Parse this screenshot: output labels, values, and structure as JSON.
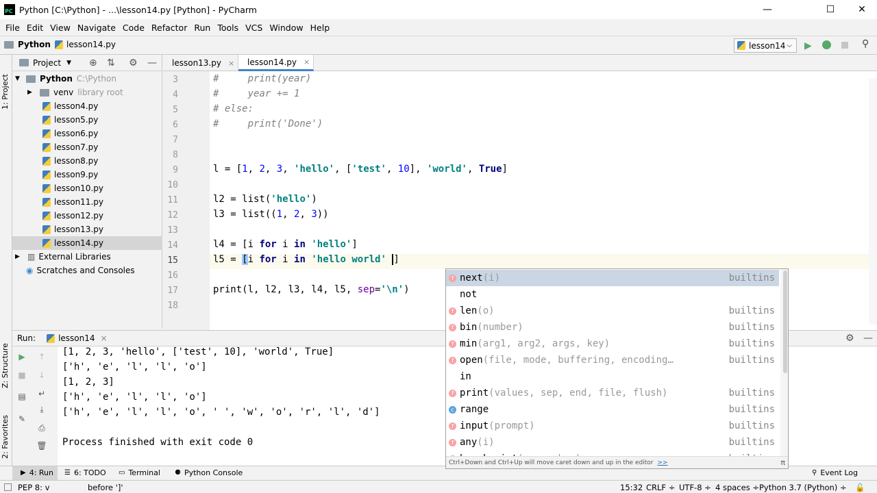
{
  "window": {
    "title": "Python [C:\\Python] - ...\\lesson14.py [Python] - PyCharm",
    "minimize": "—",
    "maximize": "☐",
    "close": "✕"
  },
  "menu": [
    "File",
    "Edit",
    "View",
    "Navigate",
    "Code",
    "Refactor",
    "Run",
    "Tools",
    "VCS",
    "Window",
    "Help"
  ],
  "breadcrumb": {
    "project": "Python",
    "file": "lesson14.py"
  },
  "run_config": {
    "label": "lesson14",
    "run_icon": "play-icon",
    "debug_icon": "bug-icon",
    "stop_icon": "stop-icon",
    "search_icon": "search-icon"
  },
  "left_strip": {
    "project_tab": "1: Project",
    "structure_tab": "Z: Structure",
    "favorites_tab": "2: Favorites"
  },
  "project_panel": {
    "title": "Project",
    "tree": [
      {
        "label": "Python",
        "hint": "C:\\Python",
        "type": "root"
      },
      {
        "label": "venv",
        "hint": "library root",
        "type": "folder"
      },
      {
        "label": "lesson4.py",
        "type": "file"
      },
      {
        "label": "lesson5.py",
        "type": "file"
      },
      {
        "label": "lesson6.py",
        "type": "file"
      },
      {
        "label": "lesson7.py",
        "type": "file"
      },
      {
        "label": "lesson8.py",
        "type": "file"
      },
      {
        "label": "lesson9.py",
        "type": "file"
      },
      {
        "label": "lesson10.py",
        "type": "file"
      },
      {
        "label": "lesson11.py",
        "type": "file"
      },
      {
        "label": "lesson12.py",
        "type": "file"
      },
      {
        "label": "lesson13.py",
        "type": "file"
      },
      {
        "label": "lesson14.py",
        "type": "file",
        "selected": true
      },
      {
        "label": "External Libraries",
        "type": "lib"
      },
      {
        "label": "Scratches and Consoles",
        "type": "scratch"
      }
    ]
  },
  "editor_tabs": [
    {
      "label": "lesson13.py",
      "close": "×"
    },
    {
      "label": "lesson14.py",
      "close": "×",
      "active": true
    }
  ],
  "editor": {
    "line_numbers": [
      "3",
      "4",
      "5",
      "6",
      "7",
      "8",
      "9",
      "10",
      "11",
      "12",
      "13",
      "14",
      "15",
      "16",
      "17",
      "18"
    ],
    "current_line": "15"
  },
  "completion": {
    "items": [
      {
        "name": "next",
        "params": "(i)",
        "source": "builtins",
        "kind": "f",
        "selected": true
      },
      {
        "name": "not",
        "params": "",
        "source": "",
        "kind": ""
      },
      {
        "name": "len",
        "params": "(o)",
        "source": "builtins",
        "kind": "f"
      },
      {
        "name": "bin",
        "params": "(number)",
        "source": "builtins",
        "kind": "f"
      },
      {
        "name": "min",
        "params": "(arg1, arg2, args, key)",
        "source": "builtins",
        "kind": "f"
      },
      {
        "name": "open",
        "params": "(file, mode, buffering, encoding…",
        "source": "builtins",
        "kind": "f"
      },
      {
        "name": "in",
        "params": "",
        "source": "",
        "kind": ""
      },
      {
        "name": "print",
        "params": "(values, sep, end, file, flush)",
        "source": "builtins",
        "kind": "f"
      },
      {
        "name": "range",
        "params": "",
        "source": "builtins",
        "kind": "c"
      },
      {
        "name": "input",
        "params": "(prompt)",
        "source": "builtins",
        "kind": "f"
      },
      {
        "name": "any",
        "params": "(i)",
        "source": "builtins",
        "kind": "f"
      },
      {
        "name": "breakpoint",
        "params": "(args, kws)",
        "source": "builtins",
        "kind": "f"
      }
    ],
    "hint": "Ctrl+Down and Ctrl+Up will move caret down and up in the editor",
    "hint_link": ">>",
    "pi": "π"
  },
  "run_panel": {
    "label": "Run:",
    "tab": "lesson14",
    "tab_close": "×",
    "output": [
      "[1, 2, 3, 'hello', ['test', 10], 'world', True]",
      "['h', 'e', 'l', 'l', 'o']",
      "[1, 2, 3]",
      "['h', 'e', 'l', 'l', 'o']",
      "['h', 'e', 'l', 'l', 'o', ' ', 'w', 'o', 'r', 'l', 'd']",
      "",
      "Process finished with exit code 0"
    ]
  },
  "bottom_tabs": [
    {
      "label": "4: Run",
      "icon": "play-icon"
    },
    {
      "label": "6: TODO",
      "icon": "list-icon"
    },
    {
      "label": "Terminal",
      "icon": "terminal-icon"
    },
    {
      "label": "Python Console",
      "icon": "python-icon"
    },
    {
      "label": "Event Log",
      "icon": "search-icon"
    }
  ],
  "status": {
    "message": "PEP 8: v",
    "message_tail": "before ']'",
    "position": "15:32",
    "line_sep": "CRLF ÷",
    "encoding": "UTF-8 ÷",
    "indent": "4 spaces ÷",
    "interpreter": "Python 3.7 (Python) ÷"
  },
  "colors": {
    "accent": "#4083c9",
    "run_green": "#59a869",
    "completion_selected": "#cad6e3"
  }
}
